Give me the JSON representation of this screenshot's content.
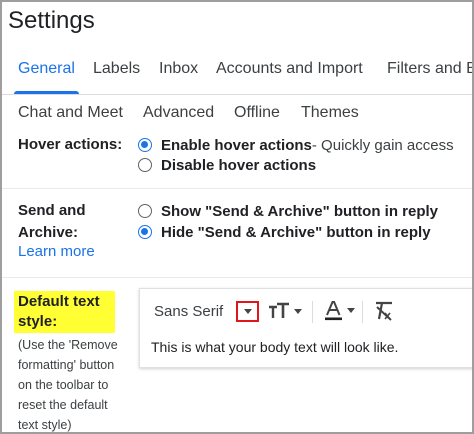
{
  "page": {
    "title": "Settings"
  },
  "tabs_primary": [
    {
      "label": "General",
      "active": true
    },
    {
      "label": "Labels"
    },
    {
      "label": "Inbox"
    },
    {
      "label": "Accounts and Import"
    },
    {
      "label": "Filters and B"
    }
  ],
  "tabs_secondary": [
    {
      "label": "Chat and Meet"
    },
    {
      "label": "Advanced"
    },
    {
      "label": "Offline"
    },
    {
      "label": "Themes"
    }
  ],
  "hover_actions": {
    "label": "Hover actions:",
    "options": [
      {
        "bold": "Enable hover actions",
        "desc": " - Quickly gain access",
        "checked": true
      },
      {
        "bold": "Disable hover actions",
        "desc": "",
        "checked": false
      }
    ]
  },
  "send_archive": {
    "label_line1": "Send and",
    "label_line2": "Archive:",
    "learn_more": "Learn more",
    "options": [
      {
        "bold": "Show \"Send & Archive\" button in reply",
        "checked": false
      },
      {
        "bold": "Hide \"Send & Archive\" button in reply",
        "checked": true
      }
    ]
  },
  "default_text_style": {
    "label_line1": "Default text",
    "label_line2": "style:",
    "help_lines": [
      "(Use the 'Remove",
      "formatting' button",
      "on the toolbar to",
      "reset the default",
      "text style)"
    ],
    "toolbar": {
      "font": "Sans Serif",
      "icons": [
        "font-dropdown-icon",
        "text-size-icon",
        "text-color-icon",
        "remove-formatting-icon"
      ]
    },
    "preview_text": "This is what your body text will look like."
  },
  "colors": {
    "accent": "#1a73e8",
    "highlight": "#ffff33",
    "callout_border": "#e0161a"
  }
}
